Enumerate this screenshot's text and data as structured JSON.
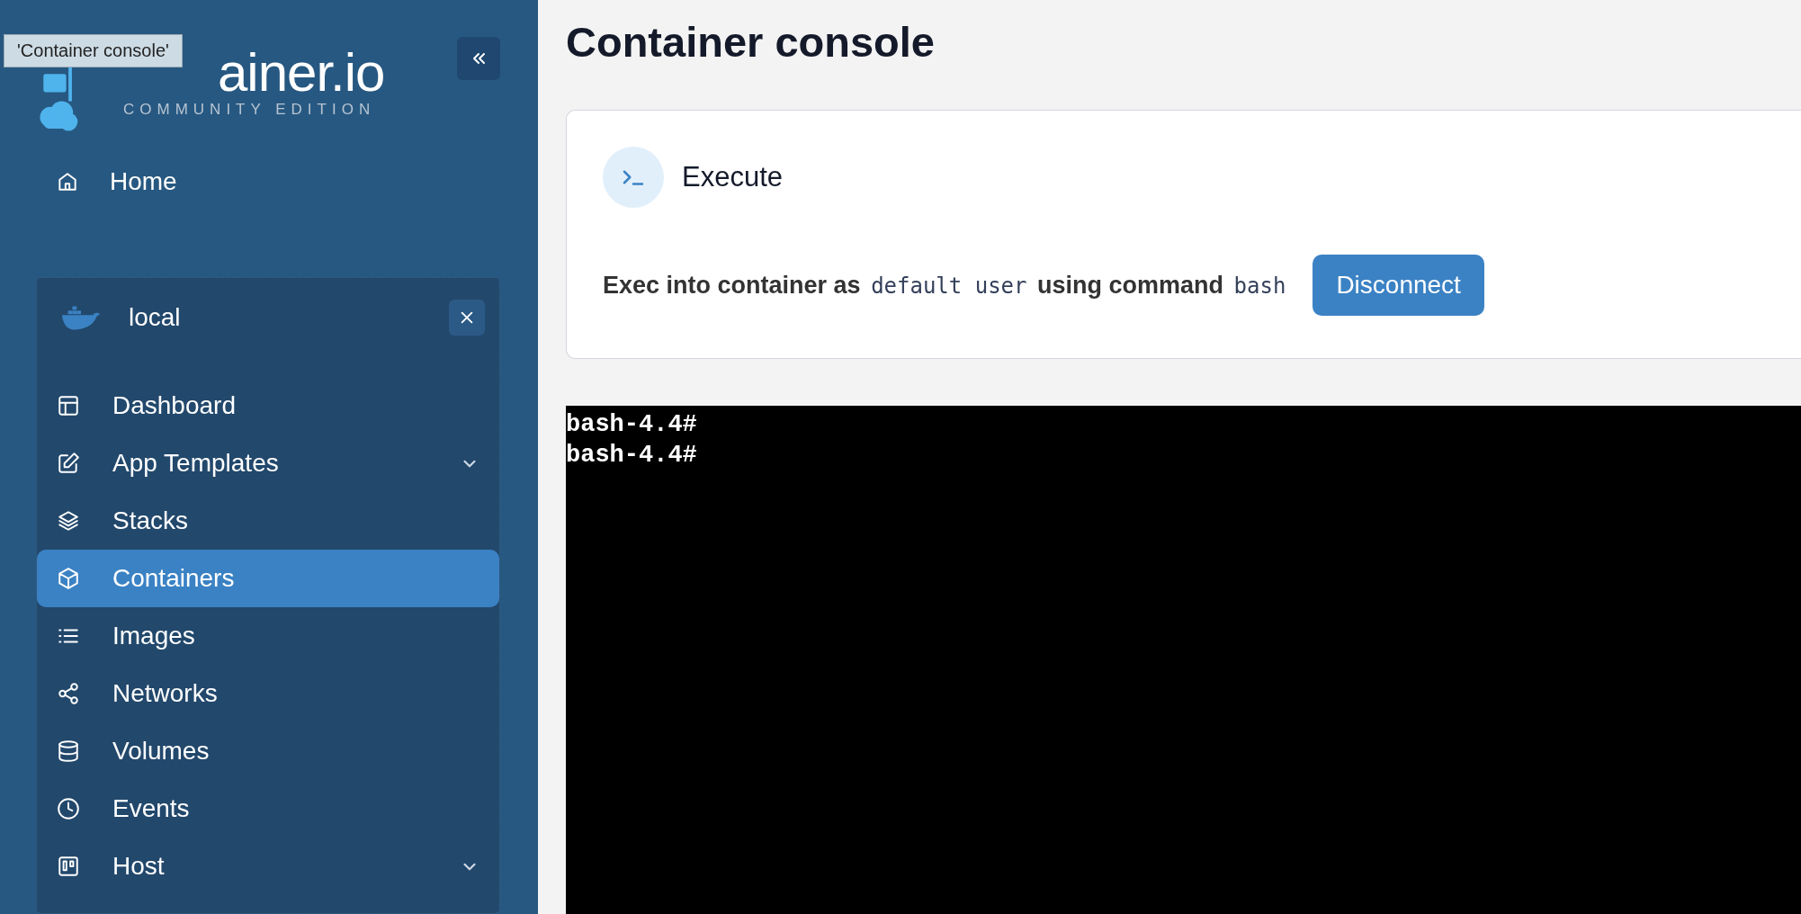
{
  "tooltip": "'Container console'",
  "logo": {
    "name": "ainer.io",
    "subtitle": "COMMUNITY EDITION"
  },
  "home": {
    "label": "Home"
  },
  "environment": {
    "name": "local",
    "items": [
      {
        "label": "Dashboard",
        "selected": false,
        "expandable": false
      },
      {
        "label": "App Templates",
        "selected": false,
        "expandable": true
      },
      {
        "label": "Stacks",
        "selected": false,
        "expandable": false
      },
      {
        "label": "Containers",
        "selected": true,
        "expandable": false
      },
      {
        "label": "Images",
        "selected": false,
        "expandable": false
      },
      {
        "label": "Networks",
        "selected": false,
        "expandable": false
      },
      {
        "label": "Volumes",
        "selected": false,
        "expandable": false
      },
      {
        "label": "Events",
        "selected": false,
        "expandable": false
      },
      {
        "label": "Host",
        "selected": false,
        "expandable": true
      }
    ]
  },
  "page_title": "Container console",
  "card": {
    "title": "Execute",
    "sentence": [
      {
        "kind": "text",
        "text": "Exec into container as"
      },
      {
        "kind": "code",
        "text": "default user"
      },
      {
        "kind": "text",
        "text": "using command"
      },
      {
        "kind": "code",
        "text": "bash"
      }
    ],
    "button": "Disconnect"
  },
  "terminal": {
    "lines": [
      "bash-4.4#",
      "bash-4.4#"
    ]
  }
}
